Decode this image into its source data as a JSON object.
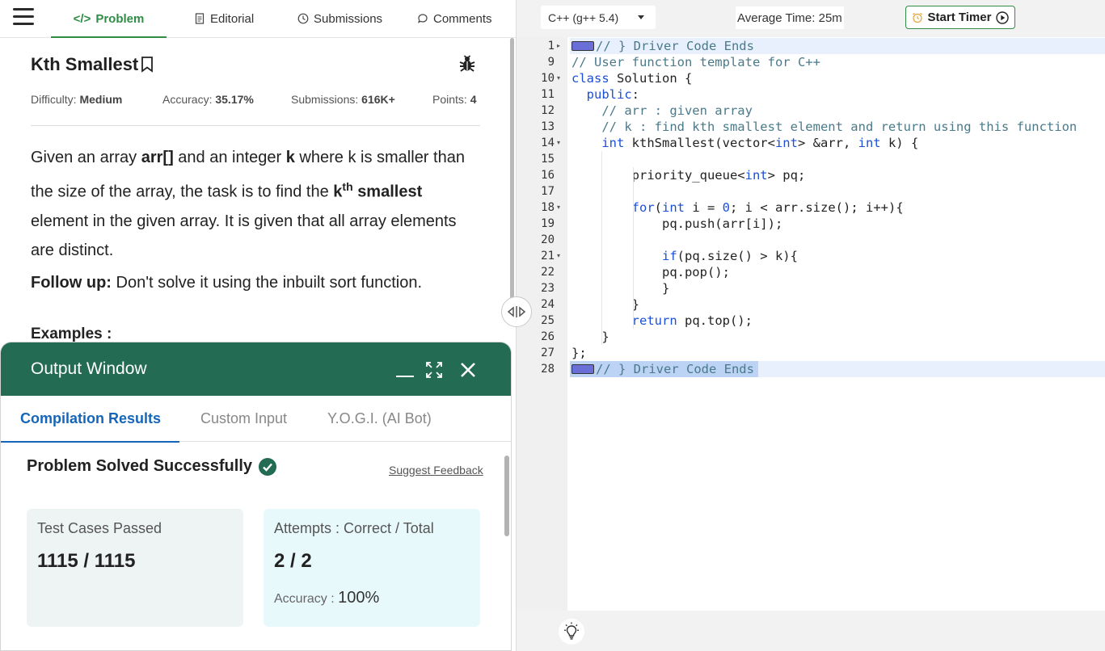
{
  "nav": {
    "tabs": [
      {
        "label": "Problem",
        "icon": "code-icon"
      },
      {
        "label": "Editorial",
        "icon": "document-icon"
      },
      {
        "label": "Submissions",
        "icon": "clock-icon"
      },
      {
        "label": "Comments",
        "icon": "comment-icon"
      }
    ],
    "active_color": "#2f8d46"
  },
  "problem": {
    "title": "Kth Smallest",
    "difficulty_label": "Difficulty:",
    "difficulty": "Medium",
    "accuracy_label": "Accuracy:",
    "accuracy": "35.17%",
    "submissions_label": "Submissions:",
    "submissions": "616K+",
    "points_label": "Points:",
    "points": "4",
    "statement": {
      "p1": "Given an array ",
      "arr": "arr[]",
      "p2": " and an integer ",
      "k": "k",
      "p3": " where k is smaller than the size of the array, the task is to find the ",
      "kth_k": "k",
      "kth_sup": "th",
      "smallest": "smallest",
      "p4": " element in the given array. It is given that all array elements are distinct."
    },
    "followup_label": "Follow up:",
    "followup_text": " Don't solve it using the inbuilt sort function.",
    "examples_label": "Examples :"
  },
  "output": {
    "title": "Output Window",
    "header_color": "#236b53",
    "tabs": [
      "Compilation Results",
      "Custom Input",
      "Y.O.G.I. (AI Bot)"
    ],
    "result_title": "Problem Solved Successfully",
    "feedback": "Suggest Feedback",
    "tests_label": "Test Cases Passed",
    "tests_value": "1115 / 1115",
    "attempts_label": "Attempts : Correct / Total",
    "attempts_value": "2 / 2",
    "accuracy_label": "Accuracy :",
    "accuracy_value": "100%"
  },
  "editor": {
    "language": "C++ (g++ 5.4)",
    "avg_time": "Average Time: 25m",
    "timer_label": "Start Timer",
    "lines": [
      {
        "n": "1",
        "fold": "▸",
        "html": "<span class=\"fold-marker\"></span><span class=\"cm\">// } Driver Code Ends</span>"
      },
      {
        "n": "9",
        "fold": "",
        "html": "<span class=\"cm\">// User function template for C++</span>"
      },
      {
        "n": "10",
        "fold": "▾",
        "html": "<span class=\"kw\">class</span> Solution {"
      },
      {
        "n": "11",
        "fold": "",
        "html": "  <span class=\"kw\">public</span>:"
      },
      {
        "n": "12",
        "fold": "",
        "html": "    <span class=\"cm\">// arr : given array</span>"
      },
      {
        "n": "13",
        "fold": "",
        "html": "    <span class=\"cm\">// k : find kth smallest element and return using this function</span>"
      },
      {
        "n": "14",
        "fold": "▾",
        "html": "    <span class=\"kw\">int</span> kthSmallest(vector&lt;<span class=\"kw\">int</span>&gt; &amp;arr, <span class=\"kw\">int</span> k) {"
      },
      {
        "n": "15",
        "fold": "",
        "html": ""
      },
      {
        "n": "16",
        "fold": "",
        "html": "        priority_queue&lt;<span class=\"kw\">int</span>&gt; pq;"
      },
      {
        "n": "17",
        "fold": "",
        "html": ""
      },
      {
        "n": "18",
        "fold": "▾",
        "html": "        <span class=\"kw\">for</span>(<span class=\"kw\">int</span> i = <span class=\"num\">0</span>; i &lt; arr.size(); i++){"
      },
      {
        "n": "19",
        "fold": "",
        "html": "            pq.push(arr[i]);"
      },
      {
        "n": "20",
        "fold": "",
        "html": ""
      },
      {
        "n": "21",
        "fold": "▾",
        "html": "            <span class=\"kw\">if</span>(pq.size() &gt; k){"
      },
      {
        "n": "22",
        "fold": "",
        "html": "            pq.pop();"
      },
      {
        "n": "23",
        "fold": "",
        "html": "            }"
      },
      {
        "n": "24",
        "fold": "",
        "html": "        }"
      },
      {
        "n": "25",
        "fold": "",
        "html": "        <span class=\"kw\">return</span> pq.top();"
      },
      {
        "n": "26",
        "fold": "",
        "html": "    }"
      },
      {
        "n": "27",
        "fold": "",
        "html": "};"
      },
      {
        "n": "28",
        "fold": "",
        "html": "<span class=\"fold-marker\"></span><span class=\"cm\">// } Driver Code Ends</span>"
      }
    ]
  }
}
